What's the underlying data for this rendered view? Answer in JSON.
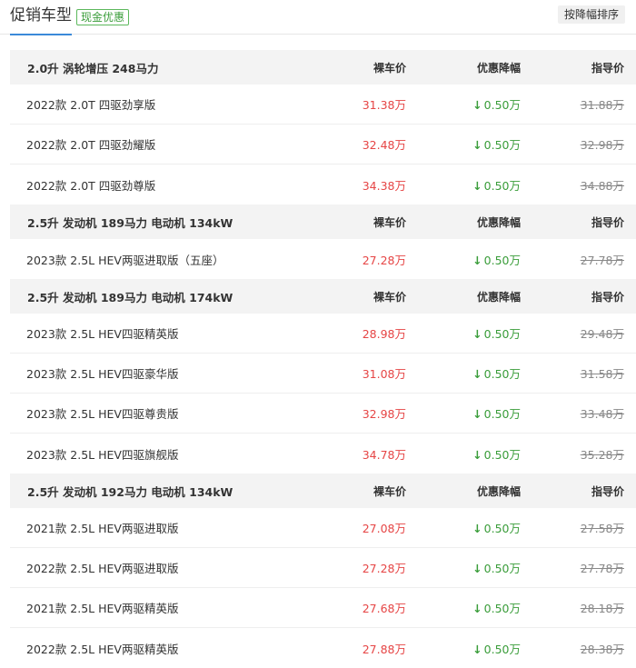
{
  "header": {
    "title": "促销车型",
    "badge": "现金优惠",
    "sort_label": "按降幅排序"
  },
  "colors": {
    "accent": "#3b8ad9",
    "price": "#e64545",
    "discount": "#3a9d3a",
    "guide": "#888888"
  },
  "icons": {
    "discount_arrow": "arrow-down-icon"
  },
  "columns": {
    "price": "裸车价",
    "discount": "优惠降幅",
    "guide": "指导价"
  },
  "groups": [
    {
      "engine": "2.0升 涡轮增压 248马力",
      "models": [
        {
          "name": "2022款 2.0T 四驱劲享版",
          "price": "31.38万",
          "discount": "0.50万",
          "guide": "31.88万"
        },
        {
          "name": "2022款 2.0T 四驱劲耀版",
          "price": "32.48万",
          "discount": "0.50万",
          "guide": "32.98万"
        },
        {
          "name": "2022款 2.0T 四驱劲尊版",
          "price": "34.38万",
          "discount": "0.50万",
          "guide": "34.88万"
        }
      ]
    },
    {
      "engine": "2.5升 发动机 189马力 电动机 134kW",
      "models": [
        {
          "name": "2023款 2.5L HEV两驱进取版（五座）",
          "price": "27.28万",
          "discount": "0.50万",
          "guide": "27.78万"
        }
      ]
    },
    {
      "engine": "2.5升 发动机 189马力 电动机 174kW",
      "models": [
        {
          "name": "2023款 2.5L HEV四驱精英版",
          "price": "28.98万",
          "discount": "0.50万",
          "guide": "29.48万"
        },
        {
          "name": "2023款 2.5L HEV四驱豪华版",
          "price": "31.08万",
          "discount": "0.50万",
          "guide": "31.58万"
        },
        {
          "name": "2023款 2.5L HEV四驱尊贵版",
          "price": "32.98万",
          "discount": "0.50万",
          "guide": "33.48万"
        },
        {
          "name": "2023款 2.5L HEV四驱旗舰版",
          "price": "34.78万",
          "discount": "0.50万",
          "guide": "35.28万"
        }
      ]
    },
    {
      "engine": "2.5升 发动机 192马力 电动机 134kW",
      "models": [
        {
          "name": "2021款 2.5L HEV两驱进取版",
          "price": "27.08万",
          "discount": "0.50万",
          "guide": "27.58万"
        },
        {
          "name": "2022款 2.5L HEV两驱进取版",
          "price": "27.28万",
          "discount": "0.50万",
          "guide": "27.78万"
        },
        {
          "name": "2021款 2.5L HEV两驱精英版",
          "price": "27.68万",
          "discount": "0.50万",
          "guide": "28.18万"
        },
        {
          "name": "2022款 2.5L HEV两驱精英版",
          "price": "27.88万",
          "discount": "0.50万",
          "guide": "28.38万"
        }
      ]
    }
  ]
}
